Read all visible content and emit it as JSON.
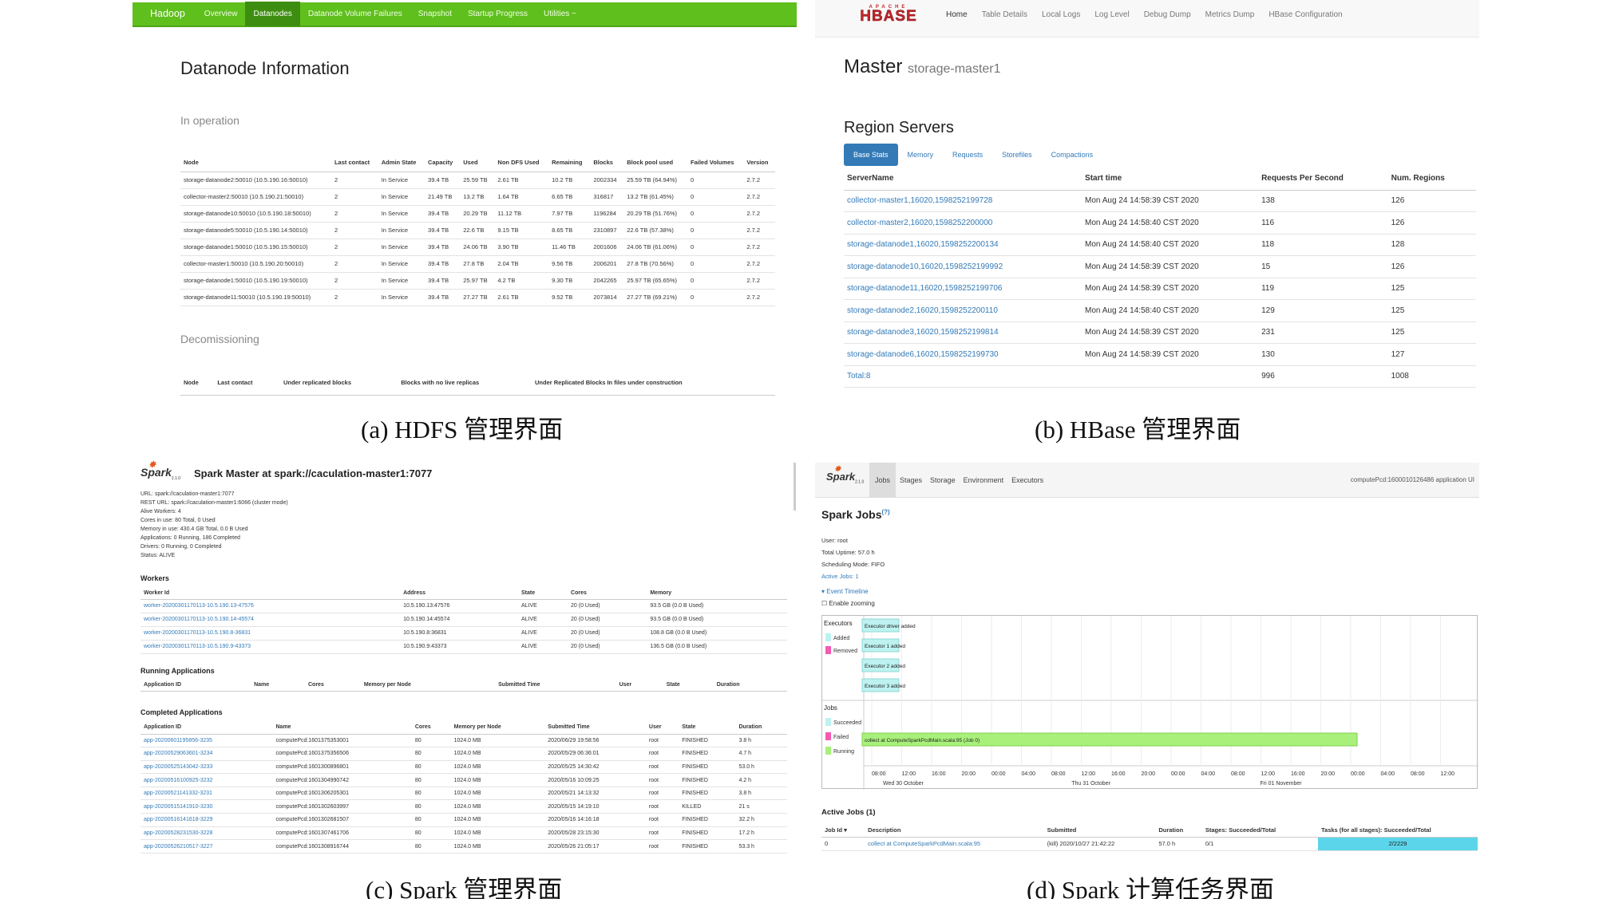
{
  "hdfs": {
    "nav": [
      "Hadoop",
      "Overview",
      "Datanodes",
      "Datanode Volume Failures",
      "Snapshot",
      "Startup Progress",
      "Utilities ~"
    ],
    "title": "Datanode Information",
    "in_operation": "In operation",
    "columns": [
      "Node",
      "Last contact",
      "Admin State",
      "Capacity",
      "Used",
      "Non DFS Used",
      "Remaining",
      "Blocks",
      "Block pool used",
      "Failed Volumes",
      "Version"
    ],
    "rows": [
      [
        "storage-datanode2:50010 (10.5.190.16:50010)",
        "2",
        "In Service",
        "39.4 TB",
        "25.59 TB",
        "2.61 TB",
        "10.2 TB",
        "2002334",
        "25.59 TB (64.94%)",
        "0",
        "2.7.2"
      ],
      [
        "collector-master2:50010 (10.5.190.21:50010)",
        "2",
        "In Service",
        "21.49 TB",
        "13.2 TB",
        "1.64 TB",
        "6.65 TB",
        "316817",
        "13.2 TB (61.45%)",
        "0",
        "2.7.2"
      ],
      [
        "storage-datanode10:50010 (10.5.190.18:50010)",
        "2",
        "In Service",
        "39.4 TB",
        "20.29 TB",
        "11.12 TB",
        "7.97 TB",
        "1196284",
        "20.29 TB (51.76%)",
        "0",
        "2.7.2"
      ],
      [
        "storage-datanode5:50010 (10.5.190.14:50010)",
        "2",
        "In Service",
        "39.4 TB",
        "22.6 TB",
        "9.15 TB",
        "8.65 TB",
        "2310897",
        "22.6 TB (57.38%)",
        "0",
        "2.7.2"
      ],
      [
        "storage-datanode1:50010 (10.5.190.15:50010)",
        "2",
        "In Service",
        "39.4 TB",
        "24.06 TB",
        "3.90 TB",
        "11.46 TB",
        "2001606",
        "24.06 TB (61.06%)",
        "0",
        "2.7.2"
      ],
      [
        "collector-master1:50010 (10.5.190.20:50010)",
        "2",
        "In Service",
        "39.4 TB",
        "27.8 TB",
        "2.04 TB",
        "9.56 TB",
        "2006201",
        "27.8 TB (70.56%)",
        "0",
        "2.7.2"
      ],
      [
        "storage-datanode1:50010 (10.5.190.19:50010)",
        "2",
        "In Service",
        "39.4 TB",
        "25.97 TB",
        "4.2 TB",
        "9.30 TB",
        "2042265",
        "25.97 TB (65.65%)",
        "0",
        "2.7.2"
      ],
      [
        "storage-datanode11:50010 (10.5.190.19:50010)",
        "2",
        "In Service",
        "39.4 TB",
        "27.27 TB",
        "2.61 TB",
        "9.52 TB",
        "2073814",
        "27.27 TB (69.21%)",
        "0",
        "2.7.2"
      ]
    ],
    "decom": "Decomissioning",
    "decom_cols": [
      "Node",
      "Last contact",
      "Under replicated blocks",
      "Blocks with no live replicas",
      "Under Replicated Blocks In files under construction"
    ]
  },
  "hbase": {
    "logo_top": "APACHE",
    "logo": "HBASE",
    "nav": [
      "Home",
      "Table Details",
      "Local Logs",
      "Log Level",
      "Debug Dump",
      "Metrics Dump",
      "HBase Configuration"
    ],
    "title": "Master",
    "subtitle": "storage-master1",
    "section": "Region Servers",
    "tabs": [
      "Base Stats",
      "Memory",
      "Requests",
      "Storefiles",
      "Compactions"
    ],
    "columns": [
      "ServerName",
      "Start time",
      "Requests Per Second",
      "Num. Regions"
    ],
    "rows": [
      [
        "collector-master1,16020,1598252199728",
        "Mon Aug 24 14:58:39 CST 2020",
        "138",
        "126"
      ],
      [
        "collector-master2,16020,1598252200000",
        "Mon Aug 24 14:58:40 CST 2020",
        "116",
        "126"
      ],
      [
        "storage-datanode1,16020,1598252200134",
        "Mon Aug 24 14:58:40 CST 2020",
        "118",
        "128"
      ],
      [
        "storage-datanode10,16020,1598252199992",
        "Mon Aug 24 14:58:39 CST 2020",
        "15",
        "126"
      ],
      [
        "storage-datanode11,16020,1598252199706",
        "Mon Aug 24 14:58:39 CST 2020",
        "119",
        "125"
      ],
      [
        "storage-datanode2,16020,1598252200110",
        "Mon Aug 24 14:58:40 CST 2020",
        "129",
        "125"
      ],
      [
        "storage-datanode3,16020,1598252199814",
        "Mon Aug 24 14:58:39 CST 2020",
        "231",
        "125"
      ],
      [
        "storage-datanode6,16020,1598252199730",
        "Mon Aug 24 14:58:39 CST 2020",
        "130",
        "127"
      ]
    ],
    "total": [
      "Total:8",
      "",
      "996",
      "1008"
    ]
  },
  "spark_master": {
    "logo": "Spark",
    "version": "2.1.0",
    "title": "Spark Master at spark://caculation-master1:7077",
    "meta": [
      "URL: spark://caculation-master1:7077",
      "REST URL: spark://caculation-master1:6066 (cluster mode)",
      "Alive Workers: 4",
      "Cores in use: 80 Total, 0 Used",
      "Memory in use: 430.4 GB Total, 0.0 B Used",
      "Applications: 0 Running, 186 Completed",
      "Drivers: 0 Running, 0 Completed",
      "Status: ALIVE"
    ],
    "workers_title": "Workers",
    "worker_cols": [
      "Worker Id",
      "Address",
      "State",
      "Cores",
      "Memory"
    ],
    "workers": [
      [
        "worker-20200301170113-10.5.190.13-47576",
        "10.5.190.13:47576",
        "ALIVE",
        "20 (0 Used)",
        "93.5 GB (0.0 B Used)"
      ],
      [
        "worker-20200301170113-10.5.190.14-45574",
        "10.5.190.14:45574",
        "ALIVE",
        "20 (0 Used)",
        "93.5 GB (0.0 B Used)"
      ],
      [
        "worker-20200301170113-10.5.190.8-36831",
        "10.5.190.8:36831",
        "ALIVE",
        "20 (0 Used)",
        "108.8 GB (0.0 B Used)"
      ],
      [
        "worker-20200301170113-10.5.190.9-43373",
        "10.5.190.9:43373",
        "ALIVE",
        "20 (0 Used)",
        "136.5 GB (0.0 B Used)"
      ]
    ],
    "running_title": "Running Applications",
    "running_cols": [
      "Application ID",
      "Name",
      "Cores",
      "Memory per Node",
      "Submitted Time",
      "User",
      "State",
      "Duration"
    ],
    "completed_title": "Completed Applications",
    "completed_cols": [
      "Application ID",
      "Name",
      "Cores",
      "Memory per Node",
      "Submitted Time",
      "User",
      "State",
      "Duration"
    ],
    "completed": [
      [
        "app-20200601195856-3235",
        "computePcd:1601375353001",
        "80",
        "1024.0 MB",
        "2020/06/29 19:58:56",
        "root",
        "FINISHED",
        "3.8 h"
      ],
      [
        "app-20200529063601-3234",
        "computePcd:1601375356506",
        "80",
        "1024.0 MB",
        "2020/05/29 06:36:01",
        "root",
        "FINISHED",
        "4.7 h"
      ],
      [
        "app-20200525143042-3233",
        "computePcd:1601300896801",
        "80",
        "1024.0 MB",
        "2020/05/25 14:30:42",
        "root",
        "FINISHED",
        "53.0 h"
      ],
      [
        "app-20200516100925-3232",
        "computePcd:1601304990742",
        "80",
        "1024.0 MB",
        "2020/05/16 10:09:25",
        "root",
        "FINISHED",
        "4.2 h"
      ],
      [
        "app-20200521141332-3231",
        "computePcd:1601306205301",
        "80",
        "1024.0 MB",
        "2020/05/21 14:13:32",
        "root",
        "FINISHED",
        "3.8 h"
      ],
      [
        "app-20200515141910-3230",
        "computePcd:1601302603997",
        "80",
        "1024.0 MB",
        "2020/05/15 14:19:10",
        "root",
        "KILLED",
        "21 s"
      ],
      [
        "app-20200516141618-3229",
        "computePcd:1601302681507",
        "80",
        "1024.0 MB",
        "2020/05/16 14:16:18",
        "root",
        "FINISHED",
        "32.2 h"
      ],
      [
        "app-20200528231530-3228",
        "computePcd:1601307461706",
        "80",
        "1024.0 MB",
        "2020/05/28 23:15:30",
        "root",
        "FINISHED",
        "17.2 h"
      ],
      [
        "app-20200526210517-3227",
        "computePcd:1601308916744",
        "80",
        "1024.0 MB",
        "2020/05/26 21:05:17",
        "root",
        "FINISHED",
        "53.3 h"
      ]
    ]
  },
  "spark_jobs": {
    "logo": "Spark",
    "version": "2.1.0",
    "nav": [
      "Jobs",
      "Stages",
      "Storage",
      "Environment",
      "Executors"
    ],
    "app_name": "computePcd:1600010126486 application UI",
    "title": "Spark Jobs",
    "title_sup": "(?)",
    "meta": [
      "User: root",
      "Total Uptime: 57.0 h",
      "Scheduling Mode: FIFO",
      "Active Jobs: 1"
    ],
    "event_timeline": "Event Timeline",
    "enable_zoom": "Enable zooming",
    "executors_label": "Executors",
    "legend_added": "Added",
    "legend_removed": "Removed",
    "executor_events": [
      "Executor driver added",
      "Executor 1 added",
      "Executor 2 added",
      "Executor 3 added"
    ],
    "jobs_label": "Jobs",
    "legend_succeeded": "Succeeded",
    "legend_failed": "Failed",
    "legend_running": "Running",
    "running_job": "collect at ComputeSparkPcdMain.scala:95 (Job 0)",
    "ticks": [
      "08:00",
      "12:00",
      "16:00",
      "20:00",
      "00:00",
      "04:00",
      "08:00",
      "12:00",
      "16:00",
      "20:00",
      "00:00",
      "04:00",
      "08:00",
      "12:00",
      "16:00",
      "20:00",
      "00:00",
      "04:00",
      "08:00",
      "12:00"
    ],
    "day_labels": [
      "Wed 30 October",
      "Thu 31 October",
      "Fri 01 November"
    ],
    "active_title": "Active Jobs (1)",
    "active_cols": [
      "Job Id ▾",
      "Description",
      "Submitted",
      "Duration",
      "Stages: Succeeded/Total",
      "Tasks (for all stages): Succeeded/Total"
    ],
    "active_row": [
      "0",
      "collect at ComputeSparkPcdMain.scala:95",
      "(kill) 2020/10/27 21:42:22",
      "57.0 h",
      "0/1",
      "2/2229"
    ]
  },
  "captions": [
    "(a) HDFS 管理界面",
    "(b) HBase 管理界面",
    "(c) Spark 管理界面",
    "(d) Spark 计算任务界面"
  ],
  "colors": {
    "hadoop_green": "#5fbf1c",
    "hbase_red": "#c1272d",
    "bootstrap_blue": "#337ab7",
    "spark_orange": "#e25a1c",
    "timeline_cyan": "#bdf2f0",
    "timeline_green": "#a8f07a"
  }
}
